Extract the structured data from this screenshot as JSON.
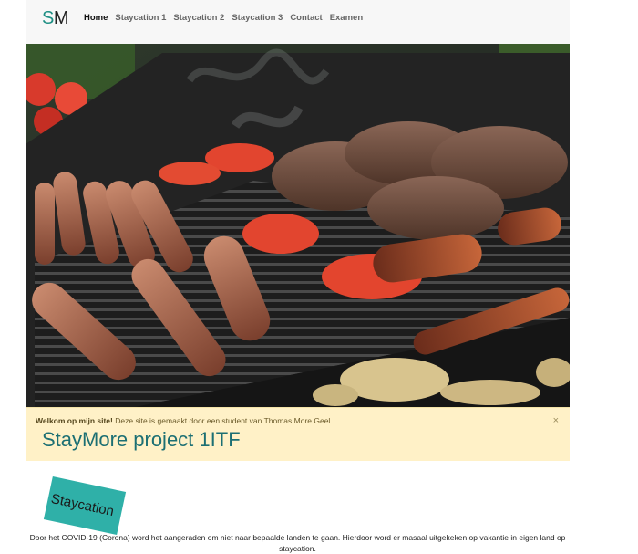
{
  "brand": {
    "s": "S",
    "m": "M"
  },
  "nav": {
    "items": [
      {
        "label": "Home",
        "active": true
      },
      {
        "label": "Staycation 1",
        "active": false
      },
      {
        "label": "Staycation 2",
        "active": false
      },
      {
        "label": "Staycation 3",
        "active": false
      },
      {
        "label": "Contact",
        "active": false
      },
      {
        "label": "Examen",
        "active": false
      }
    ]
  },
  "alert": {
    "strong": "Welkom op mijn site!",
    "text": "Deze site is gemaakt door een student van Thomas More Geel.",
    "close": "×",
    "title": "StayMore project 1ITF"
  },
  "section": {
    "tag": "Staycation",
    "intro": "Door het COVID-19 (Corona) word het aangeraden om niet naar bepaalde landen te gaan. Hierdoor word er masaal uitgekeken op vakantie in eigen land op staycation."
  }
}
